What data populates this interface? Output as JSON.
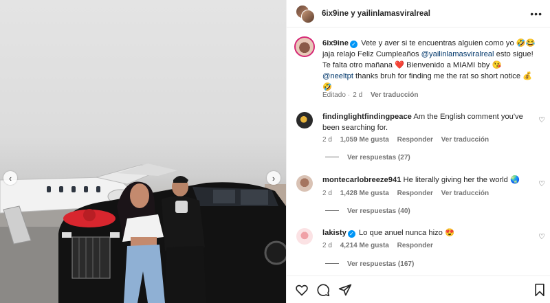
{
  "header": {
    "title": "6ix9ine y yailinlamasviralreal",
    "more_icon": "more-horizontal-icon"
  },
  "media": {
    "prev_icon": "chevron-left-icon",
    "next_icon": "chevron-right-icon"
  },
  "caption": {
    "username": "6ix9ine",
    "line1": "Vete y aver si te encuentras alguien como yo 🤣😂",
    "line2_a": "jaja relajo Feliz Cumpleaños ",
    "line2_mention": "@yailinlamasviralreal",
    "line2_b": " esto sigue!",
    "line3": "Te falta otro mañana ❤️ Bienvenido a MIAMI bby 😘",
    "line4_mention": "@neeltpt",
    "line4_b": " thanks bruh for finding me the rat so short notice 💰",
    "line5": "🤣",
    "edited": "Editado",
    "age": "2 d",
    "translate": "Ver traducción"
  },
  "comments": [
    {
      "username": "findinglightfindingpeace",
      "text_line1": "Am the English comment you've",
      "text_line2": "been searching for.",
      "age": "2 d",
      "likes": "1,059 Me gusta",
      "reply": "Responder",
      "translate": "Ver traducción",
      "replies": "Ver respuestas (27)"
    },
    {
      "username": "montecarlobreeze941",
      "text_line1": "He literally giving her the world 🌏",
      "age": "2 d",
      "likes": "1,428 Me gusta",
      "reply": "Responder",
      "translate": "Ver traducción",
      "replies": "Ver respuestas (40)"
    },
    {
      "username": "lakisty",
      "text_line1": "Lo que anuel nunca hizo 😍",
      "age": "2 d",
      "likes": "4,214 Me gusta",
      "reply": "Responder",
      "replies": "Ver respuestas (167)"
    }
  ],
  "actions": {
    "like_icon": "heart-icon",
    "comment_icon": "comment-icon",
    "share_icon": "send-icon",
    "save_icon": "bookmark-icon"
  }
}
